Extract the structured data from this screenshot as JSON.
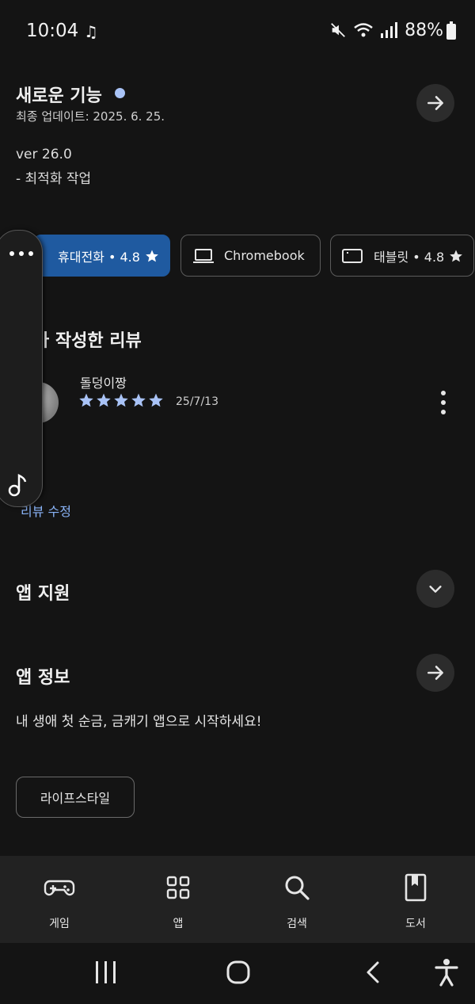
{
  "status_bar": {
    "time": "10:04",
    "battery": "88%"
  },
  "whats_new": {
    "title": "새로운 기능",
    "updated": "최종 업데이트: 2025. 6. 25.",
    "version": "ver 26.0",
    "note": "- 최적화 작업"
  },
  "device_chips": [
    {
      "label": "휴대전화 • 4.8",
      "selected": true
    },
    {
      "label": "Chromebook",
      "selected": false
    },
    {
      "label": "태블릿 • 4.8",
      "selected": false
    }
  ],
  "my_review": {
    "section_title": "가 작성한 리뷰",
    "reviewer": "돌덩이짱",
    "rating": 5,
    "date": "25/7/13",
    "edit_label": "리뷰 수정"
  },
  "app_support": {
    "title": "앱 지원"
  },
  "app_info": {
    "title": "앱 정보",
    "description": "내 생애 첫 순금, 금캐기 앱으로 시작하세요!",
    "category_tag": "라이프스타일"
  },
  "bottom_nav": [
    {
      "label": "게임",
      "icon": "gamepad-icon"
    },
    {
      "label": "앱",
      "icon": "apps-grid-icon"
    },
    {
      "label": "검색",
      "icon": "search-icon"
    },
    {
      "label": "도서",
      "icon": "book-icon"
    }
  ],
  "colors": {
    "background": "#141414",
    "accent": "#1f5aa0",
    "link": "#8ab4f8",
    "star": "#a9c3f6"
  }
}
